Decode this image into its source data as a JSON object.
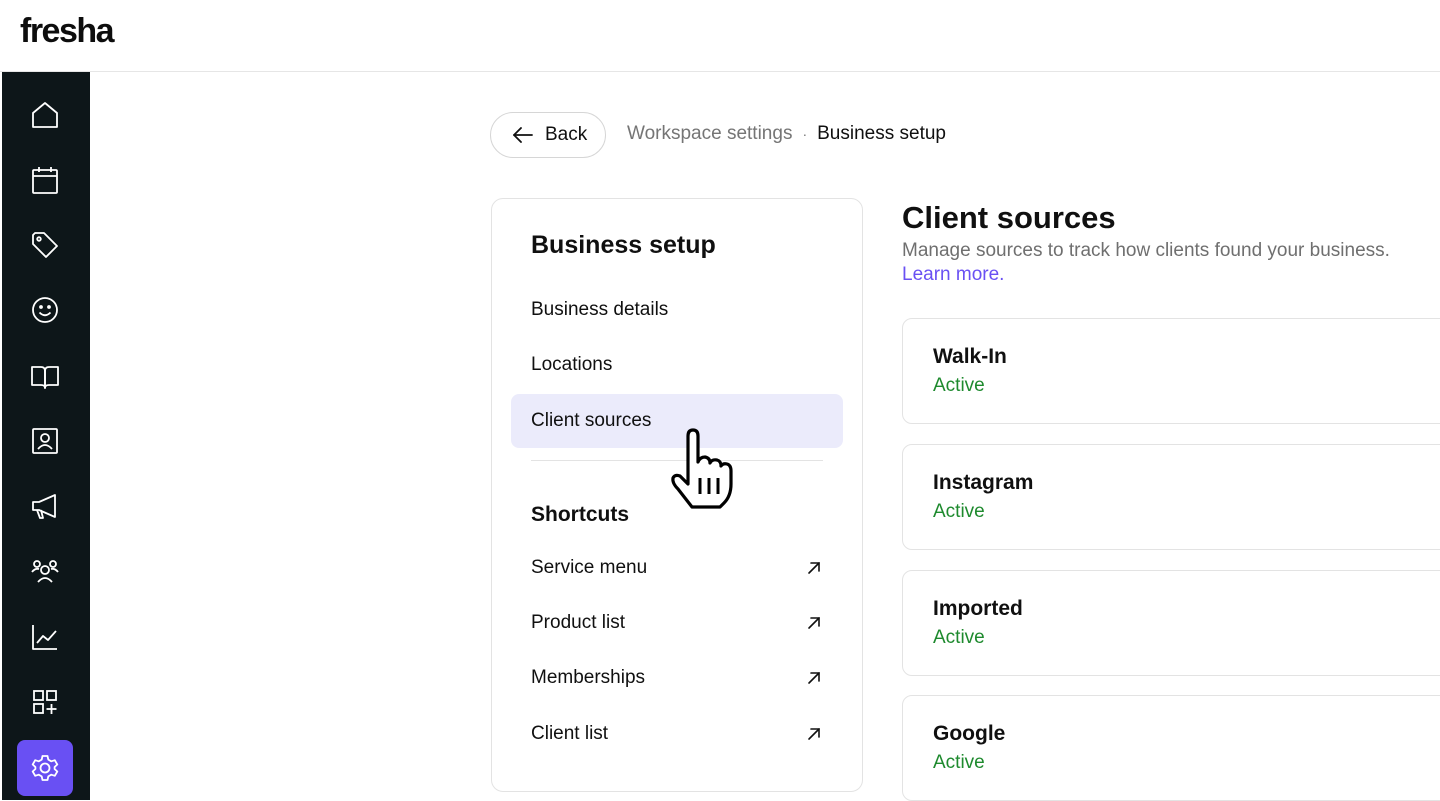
{
  "app": {
    "logo": "fresha"
  },
  "sidenav": {
    "items": [
      {
        "name": "home-icon",
        "active": false
      },
      {
        "name": "calendar-icon",
        "active": false
      },
      {
        "name": "tag-icon",
        "active": false
      },
      {
        "name": "smiley-icon",
        "active": false
      },
      {
        "name": "book-icon",
        "active": false
      },
      {
        "name": "contact-card-icon",
        "active": false
      },
      {
        "name": "megaphone-icon",
        "active": false
      },
      {
        "name": "team-icon",
        "active": false
      },
      {
        "name": "chart-icon",
        "active": false
      },
      {
        "name": "add-apps-icon",
        "active": false
      },
      {
        "name": "settings-gear-icon",
        "active": true
      }
    ],
    "active_color": "#6950f3",
    "background": "#0d1619"
  },
  "header": {
    "back_label": "Back",
    "breadcrumb": {
      "parent": "Workspace settings",
      "separator": "·",
      "current": "Business setup"
    }
  },
  "setup_menu": {
    "title": "Business setup",
    "items": [
      {
        "label": "Business details"
      },
      {
        "label": "Locations"
      },
      {
        "label": "Client sources",
        "active": true
      }
    ],
    "shortcuts_title": "Shortcuts",
    "shortcuts": [
      {
        "label": "Service menu"
      },
      {
        "label": "Product list"
      },
      {
        "label": "Memberships"
      },
      {
        "label": "Client list"
      }
    ]
  },
  "client_sources": {
    "title": "Client sources",
    "description": "Manage sources to track how clients found your business.",
    "learn_more": "Learn more.",
    "sources": [
      {
        "name": "Walk-In",
        "status": "Active"
      },
      {
        "name": "Instagram",
        "status": "Active"
      },
      {
        "name": "Imported",
        "status": "Active"
      },
      {
        "name": "Google",
        "status": "Active"
      }
    ],
    "status_color": "#1e8a2e",
    "link_color": "#6950f3"
  }
}
